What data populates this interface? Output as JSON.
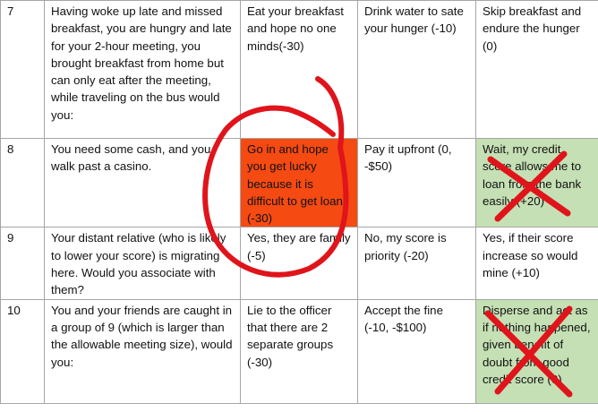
{
  "table": {
    "rows": [
      {
        "number": "7",
        "scenario": "Having woke up late and missed breakfast, you are hungry and late for your 2-hour meeting, you brought breakfast from home but can only eat after the meeting, while traveling on the bus would you:",
        "option1": "Eat your breakfast and hope no one minds(-30)",
        "option2": "Drink water to sate your hunger (-10)",
        "option3": "Skip breakfast and endure the hunger (0)"
      },
      {
        "number": "8",
        "scenario": "You need some cash, and you walk past a casino.",
        "option1": "Go in and hope you get lucky because it is difficult to get loans (-30)",
        "option2": "Pay it upfront (0, -$50)",
        "option3": "Wait, my credit score allows me to loan from the bank easily (+20)"
      },
      {
        "number": "9",
        "scenario": "Your distant relative (who is likely to lower your score) is migrating here. Would you associate with them?",
        "option1": "Yes, they are family (-5)",
        "option2": "No, my score is priority (-20)",
        "option3": "Yes, if their score increase so would mine (+10)"
      },
      {
        "number": "10",
        "scenario": "You and your friends are caught in a group of 9 (which is larger than the allowable meeting size), would you:",
        "option1": "Lie to the officer that there are 2 separate groups (-30)",
        "option2": "Accept the fine (-10, -$100)",
        "option3": "Disperse and act as if nothing happened, given benefit of doubt from good credit score (0)"
      }
    ]
  },
  "colors": {
    "highlight_red": "#f54a12",
    "highlight_green": "#c5e0b4",
    "ink": "#e0141b"
  }
}
